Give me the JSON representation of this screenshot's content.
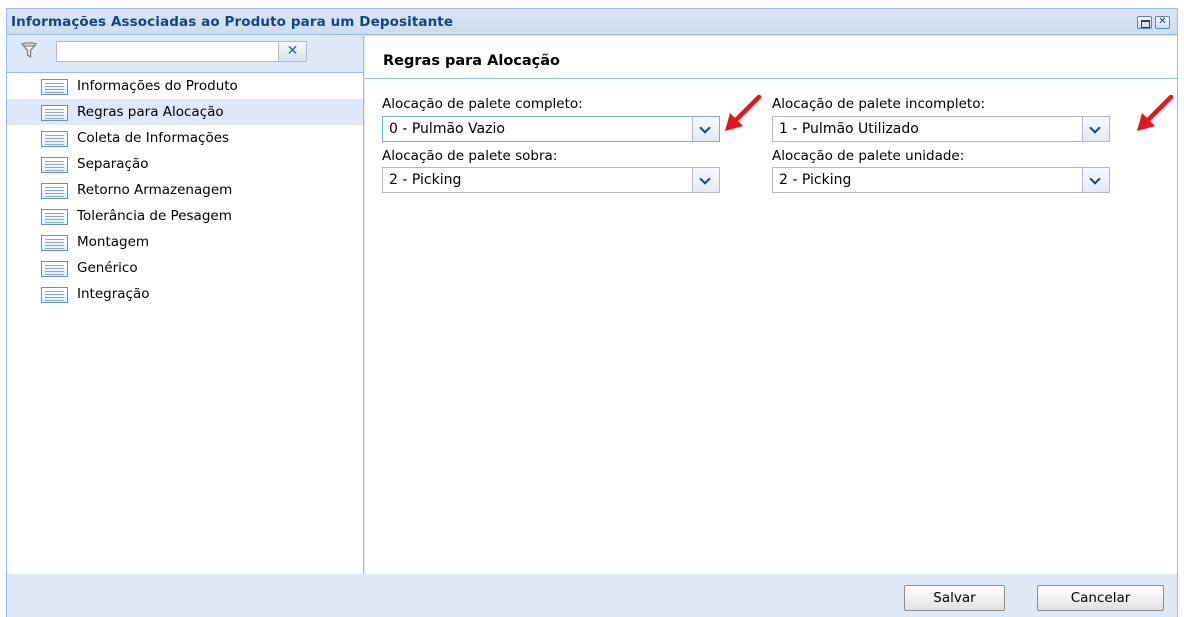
{
  "window": {
    "title": "Informações Associadas ao Produto para um Depositante"
  },
  "filter": {
    "placeholder": "",
    "value": "",
    "clear_label": "✕"
  },
  "nav": {
    "items": [
      {
        "label": "Informações do Produto",
        "selected": false
      },
      {
        "label": "Regras para Alocação",
        "selected": true
      },
      {
        "label": "Coleta de Informações",
        "selected": false
      },
      {
        "label": "Separação",
        "selected": false
      },
      {
        "label": "Retorno Armazenagem",
        "selected": false
      },
      {
        "label": "Tolerância de Pesagem",
        "selected": false
      },
      {
        "label": "Montagem",
        "selected": false
      },
      {
        "label": "Genérico",
        "selected": false
      },
      {
        "label": "Integração",
        "selected": false
      }
    ]
  },
  "panel": {
    "title": "Regras para Alocação",
    "fields": {
      "completo": {
        "label": "Alocação de palete completo:",
        "value": "0 - Pulmão Vazio"
      },
      "incompleto": {
        "label": "Alocação de palete incompleto:",
        "value": "1 - Pulmão Utilizado"
      },
      "sobra": {
        "label": "Alocação de palete sobra:",
        "value": "2 - Picking"
      },
      "unidade": {
        "label": "Alocação de palete unidade:",
        "value": "2 - Picking"
      }
    }
  },
  "footer": {
    "save_label": "Salvar",
    "cancel_label": "Cancelar"
  },
  "colors": {
    "title_text": "#15428b",
    "panel_bg": "#dfe8f6",
    "border": "#99bbe8",
    "annotation_arrow": "#e8141b"
  }
}
